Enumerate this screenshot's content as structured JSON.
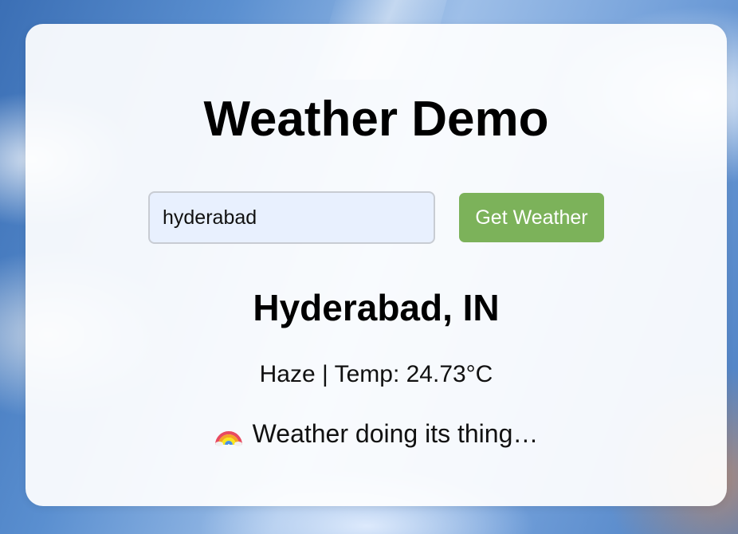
{
  "app": {
    "title": "Weather Demo"
  },
  "search": {
    "value": "hyderabad",
    "button_label": "Get Weather"
  },
  "result": {
    "location": "Hyderabad, IN",
    "summary": "Haze | Temp: 24.73°C",
    "status_icon": "rainbow-icon",
    "status_text": "Weather doing its thing…"
  },
  "colors": {
    "button": "#7cb25a",
    "input_bg": "#e8f0fe",
    "card_bg": "#ffffff"
  }
}
